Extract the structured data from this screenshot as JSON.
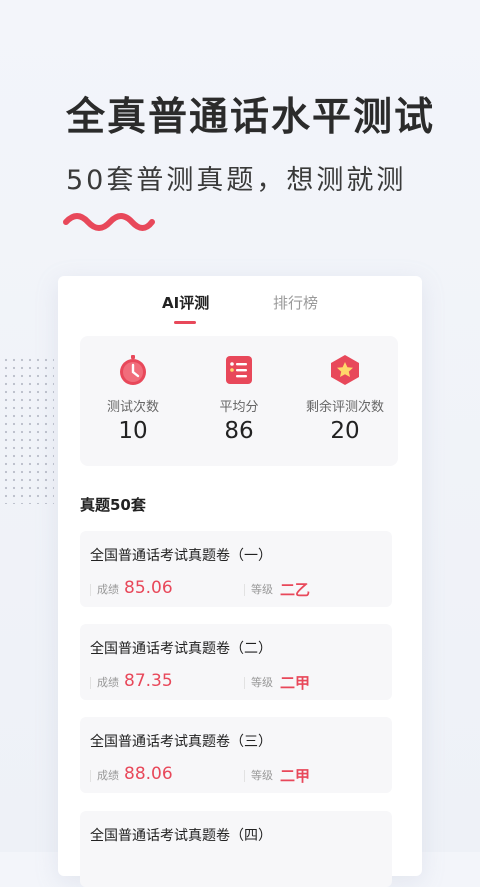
{
  "hero": {
    "title": "全真普通话水平测试",
    "subtitle": "50套普测真题，想测就测"
  },
  "colors": {
    "accent": "#e8485a",
    "background": "#f3f5fa"
  },
  "tabs": [
    {
      "label": "AI评测",
      "active": true
    },
    {
      "label": "排行榜",
      "active": false
    }
  ],
  "stats": [
    {
      "icon": "clock-icon",
      "label": "测试次数",
      "value": "10"
    },
    {
      "icon": "list-icon",
      "label": "平均分",
      "value": "86"
    },
    {
      "icon": "star-badge-icon",
      "label": "剩余评测次数",
      "value": "20"
    }
  ],
  "section": {
    "title": "真题50套"
  },
  "papers": [
    {
      "title": "全国普通话考试真题卷（一）",
      "score_label": "成绩",
      "score": "85.06",
      "grade_label": "等级",
      "grade": "二乙"
    },
    {
      "title": "全国普通话考试真题卷（二）",
      "score_label": "成绩",
      "score": "87.35",
      "grade_label": "等级",
      "grade": "二甲"
    },
    {
      "title": "全国普通话考试真题卷（三）",
      "score_label": "成绩",
      "score": "88.06",
      "grade_label": "等级",
      "grade": "二甲"
    },
    {
      "title": "全国普通话考试真题卷（四）"
    }
  ]
}
